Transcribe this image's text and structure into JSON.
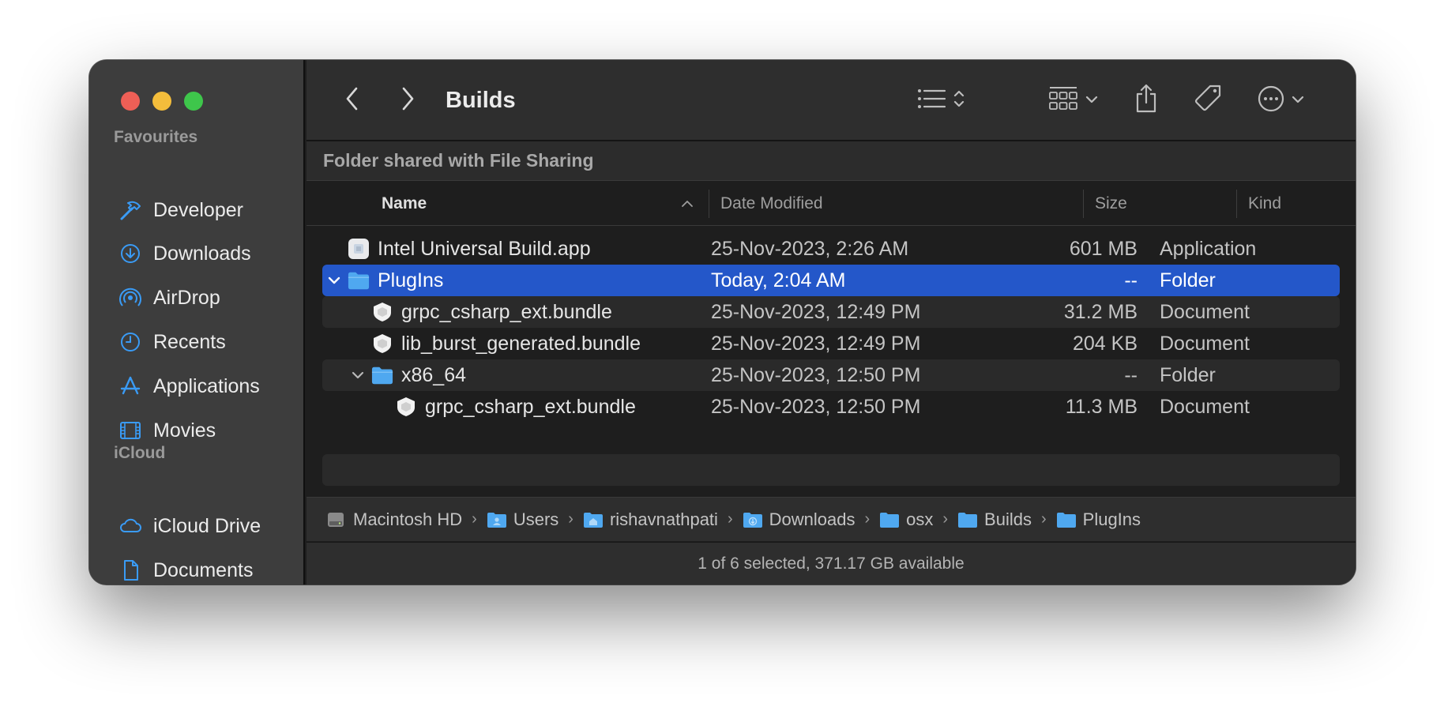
{
  "window": {
    "title": "Builds"
  },
  "sidebar": {
    "favourites_heading": "Favourites",
    "favourites": [
      {
        "label": "Developer",
        "icon": "hammer-icon"
      },
      {
        "label": "Downloads",
        "icon": "download-circle-icon"
      },
      {
        "label": "AirDrop",
        "icon": "airdrop-icon"
      },
      {
        "label": "Recents",
        "icon": "clock-icon"
      },
      {
        "label": "Applications",
        "icon": "applications-icon"
      },
      {
        "label": "Movies",
        "icon": "film-icon"
      }
    ],
    "icloud_heading": "iCloud",
    "icloud": [
      {
        "label": "iCloud Drive",
        "icon": "cloud-icon"
      },
      {
        "label": "Documents",
        "icon": "document-icon"
      }
    ]
  },
  "banner": "Folder shared with File Sharing",
  "columns": {
    "name": "Name",
    "date": "Date Modified",
    "size": "Size",
    "kind": "Kind"
  },
  "rows": [
    {
      "name": "Intel Universal Build.app",
      "date": "25-Nov-2023, 2:26 AM",
      "size": "601 MB",
      "kind": "Application",
      "icon": "app-icon",
      "depth": 0,
      "expandable": false
    },
    {
      "name": "PlugIns",
      "date": "Today, 2:04 AM",
      "size": "--",
      "kind": "Folder",
      "icon": "folder-icon",
      "depth": 0,
      "expandable": true,
      "selected": true
    },
    {
      "name": "grpc_csharp_ext.bundle",
      "date": "25-Nov-2023, 12:49 PM",
      "size": "31.2 MB",
      "kind": "Document",
      "icon": "bundle-icon",
      "depth": 1,
      "expandable": false
    },
    {
      "name": "lib_burst_generated.bundle",
      "date": "25-Nov-2023, 12:49 PM",
      "size": "204 KB",
      "kind": "Document",
      "icon": "bundle-icon",
      "depth": 1,
      "expandable": false
    },
    {
      "name": "x86_64",
      "date": "25-Nov-2023, 12:50 PM",
      "size": "--",
      "kind": "Folder",
      "icon": "folder-icon",
      "depth": 1,
      "expandable": true
    },
    {
      "name": "grpc_csharp_ext.bundle",
      "date": "25-Nov-2023, 12:50 PM",
      "size": "11.3 MB",
      "kind": "Document",
      "icon": "bundle-icon",
      "depth": 2,
      "expandable": false
    }
  ],
  "path": [
    {
      "label": "Macintosh HD",
      "icon": "disk-icon"
    },
    {
      "label": "Users",
      "icon": "users-folder-icon"
    },
    {
      "label": "rishavnathpati",
      "icon": "home-folder-icon"
    },
    {
      "label": "Downloads",
      "icon": "downloads-folder-icon"
    },
    {
      "label": "osx",
      "icon": "folder-icon"
    },
    {
      "label": "Builds",
      "icon": "folder-icon"
    },
    {
      "label": "PlugIns",
      "icon": "folder-icon"
    }
  ],
  "status": "1 of 6 selected, 371.17 GB available",
  "colors": {
    "accent": "#2457c9",
    "sidebar_icon": "#3a9bf5",
    "folder": "#4fa8f0"
  }
}
